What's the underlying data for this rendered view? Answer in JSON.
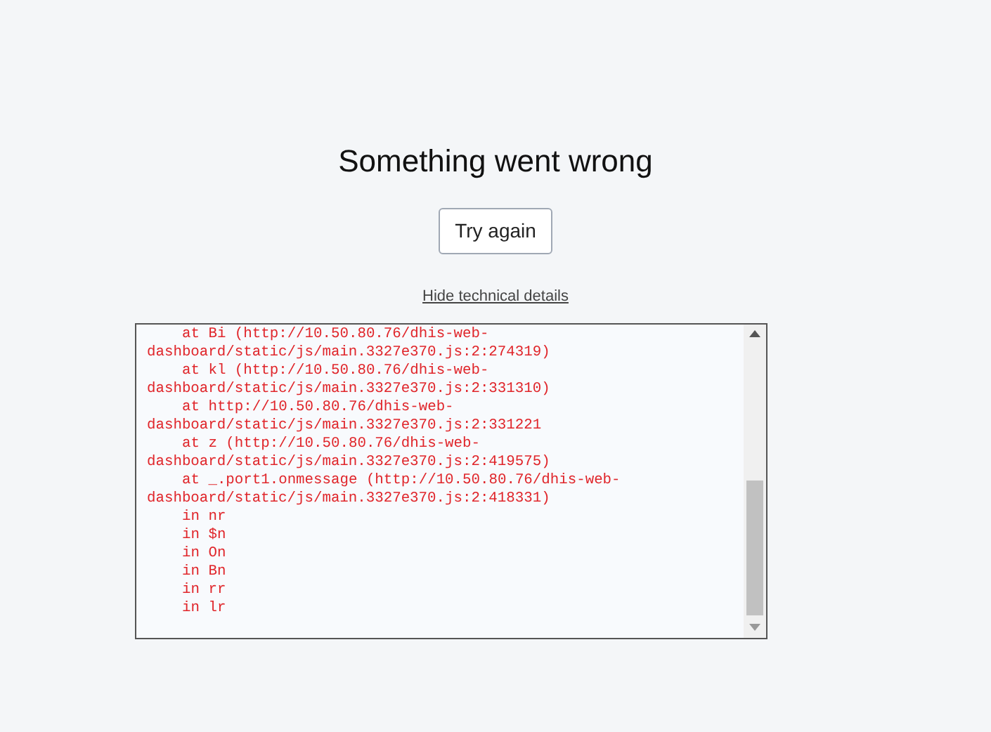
{
  "heading": "Something went wrong",
  "retry_button": "Try again",
  "details_link": "Hide technical details",
  "details_lines": [
    {
      "text": "at Bi (http://10.50.80.76/dhis-web-",
      "indented": true
    },
    {
      "text": "dashboard/static/js/main.3327e370.js:2:274319)",
      "indented": false
    },
    {
      "text": "at kl (http://10.50.80.76/dhis-web-",
      "indented": true
    },
    {
      "text": "dashboard/static/js/main.3327e370.js:2:331310)",
      "indented": false
    },
    {
      "text": "at http://10.50.80.76/dhis-web-",
      "indented": true
    },
    {
      "text": "dashboard/static/js/main.3327e370.js:2:331221",
      "indented": false
    },
    {
      "text": "at z (http://10.50.80.76/dhis-web-",
      "indented": true
    },
    {
      "text": "dashboard/static/js/main.3327e370.js:2:419575)",
      "indented": false
    },
    {
      "text": "at _.port1.onmessage (http://10.50.80.76/dhis-web-",
      "indented": true
    },
    {
      "text": "dashboard/static/js/main.3327e370.js:2:418331)",
      "indented": false
    },
    {
      "text": "in nr",
      "indented": true
    },
    {
      "text": "in $n",
      "indented": true
    },
    {
      "text": "in On",
      "indented": true
    },
    {
      "text": "in Bn",
      "indented": true
    },
    {
      "text": "in rr",
      "indented": true
    },
    {
      "text": "in lr",
      "indented": true
    }
  ]
}
